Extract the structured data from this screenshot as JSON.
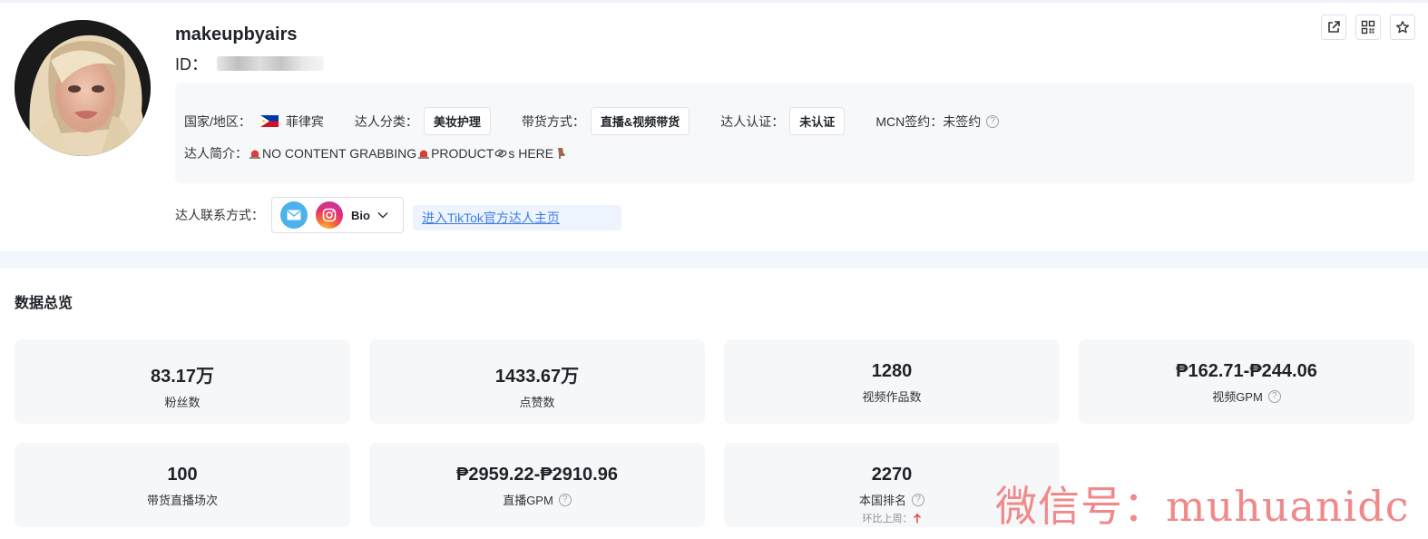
{
  "profile": {
    "nickname": "makeupbyairs",
    "id_label": "ID："
  },
  "top_actions": [
    "external-link-icon",
    "qrcode-icon",
    "star-icon"
  ],
  "info": {
    "country_label": "国家/地区：",
    "country_value": "菲律宾",
    "category_label": "达人分类：",
    "category_value": "美妆护理",
    "sales_mode_label": "带货方式：",
    "sales_mode_value": "直播&视频带货",
    "verify_label": "达人认证：",
    "verify_value": "未认证",
    "mcn_label": "MCN签约：",
    "mcn_value": "未签约",
    "bio_label": "达人简介：",
    "bio_part1": "NO CONTENT GRABBING",
    "bio_part2": " PRODUCT ",
    "bio_part3": "s HERE"
  },
  "contact": {
    "label": "达人联系方式：",
    "bio_text": "Bio",
    "tiktok_link": "进入TikTok官方达人主页"
  },
  "overview": {
    "title": "数据总览",
    "cards": [
      {
        "value": "83.17万",
        "label": "粉丝数"
      },
      {
        "value": "1433.67万",
        "label": "点赞数"
      },
      {
        "value": "1280",
        "label": "视频作品数"
      },
      {
        "value": "₱162.71-₱244.06",
        "label": "视频GPM"
      },
      {
        "value": "100",
        "label": "带货直播场次"
      },
      {
        "value": "₱2959.22-₱2910.96",
        "label": "直播GPM"
      },
      {
        "value": "2270",
        "label": "本国排名",
        "sub": "环比上周："
      }
    ]
  },
  "watermark": "微信号：muhuanidc",
  "colors": {
    "accent_link": "#3d7de8",
    "card_bg": "#f6f7f9",
    "info_bg": "#f7f8fa",
    "up_arrow": "#e8453c"
  }
}
